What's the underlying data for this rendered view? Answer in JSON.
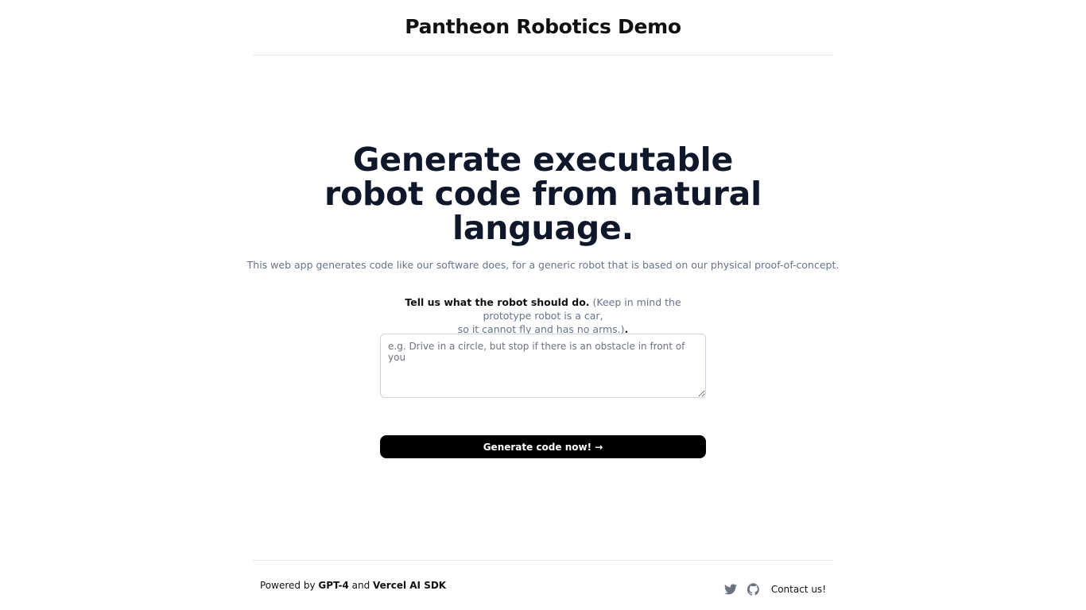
{
  "header": {
    "title": "Pantheon Robotics Demo"
  },
  "hero": {
    "title_lines": [
      "Generate executable",
      "robot code from natural",
      "language."
    ],
    "subtitle": "This web app generates code like our software does, for a generic robot that is based on our physical proof-of-concept."
  },
  "prompt": {
    "instruction_strong": "Tell us what the robot should do.",
    "instruction_note_line1": "(Keep in mind the prototype robot is a car,",
    "instruction_note_line2": "so it cannot fly and has no arms.)",
    "instruction_end": ".",
    "placeholder": "e.g. Drive in a circle, but stop if there is an obstacle in front of you",
    "value": ""
  },
  "generate_button": {
    "label": "Generate code now! →"
  },
  "footer": {
    "powered_prefix": "Powered by",
    "powered_link1": "GPT-4",
    "powered_and": "and",
    "powered_link2": "Vercel AI SDK",
    "contact_label": "Contact us!",
    "icons": [
      "twitter-icon",
      "github-icon"
    ]
  },
  "colors": {
    "primary_text": "#0f172a",
    "muted_text": "#64748b",
    "button_bg": "#000000",
    "divider": "#e5e7eb",
    "icon": "#6b7280"
  }
}
